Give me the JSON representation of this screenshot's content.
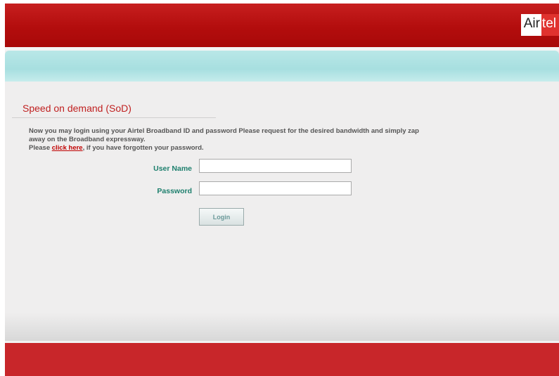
{
  "header": {
    "logo_part1": "Air",
    "logo_part2": "tel"
  },
  "section": {
    "title": "Speed on demand (SoD)"
  },
  "intro": {
    "line1": "Now you may login using your Airtel Broadband ID and password Please request for the desired bandwidth and simply zap",
    "line2": "away on the Broadband expressway.",
    "line3_prefix": "Please ",
    "link_text": "click here",
    "line3_suffix": ", if you have forgotten your password."
  },
  "form": {
    "username_label": "User Name",
    "username_value": "",
    "password_label": "Password",
    "password_value": "",
    "login_button": "Login"
  },
  "colors": {
    "brand_red": "#b30d0d",
    "teal": "#a7dfe0",
    "label_green": "#1d7f6d",
    "link_red": "#c00000"
  }
}
